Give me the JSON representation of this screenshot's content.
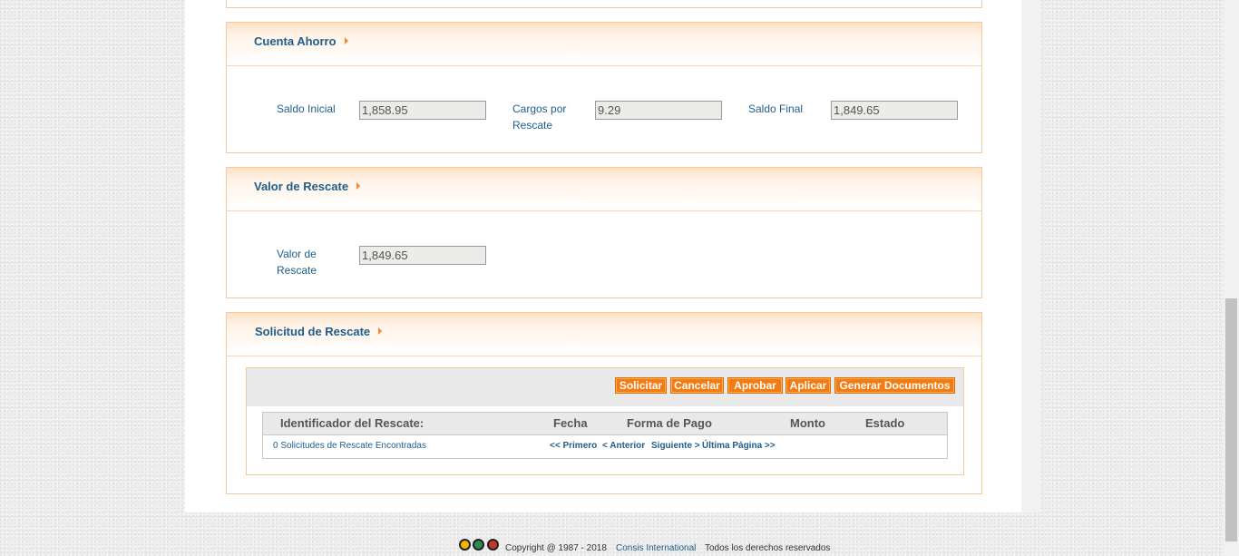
{
  "cuenta_ahorro": {
    "title": "Cuenta Ahorro",
    "saldo_inicial_label": "Saldo Inicial",
    "saldo_inicial_value": "1,858.95",
    "cargos_label_1": "Cargos por",
    "cargos_label_2": "Rescate",
    "cargos_value": "9.29",
    "saldo_final_label": "Saldo Final",
    "saldo_final_value": "1,849.65"
  },
  "valor_rescate": {
    "title": "Valor de Rescate",
    "label_1": "Valor de",
    "label_2": "Rescate",
    "value": "1,849.65"
  },
  "solicitud_rescate": {
    "title": "Solicitud de Rescate",
    "buttons": {
      "solicitar": "Solicitar",
      "cancelar": "Cancelar",
      "aprobar": "Aprobar",
      "aplicar": "Aplicar",
      "generar": "Generar Documentos"
    },
    "columns": [
      "Identificador del Rescate:",
      "Fecha",
      "Forma de Pago",
      "Monto",
      "Estado"
    ],
    "count_text": "0 Solicitudes de Rescate Encontradas",
    "pager": {
      "first": "<< Primero",
      "prev": "< Anterior",
      "next": "Siguiente >",
      "last": "Última Página >>"
    }
  },
  "footer": {
    "copyright": "Copyright @ 1987 - 2018",
    "company": "Consis International",
    "rights": "Todos los derechos reservados"
  },
  "colors": {
    "accent": "#f47b12",
    "title": "#1f5d8a",
    "border": "#f6c89a"
  }
}
